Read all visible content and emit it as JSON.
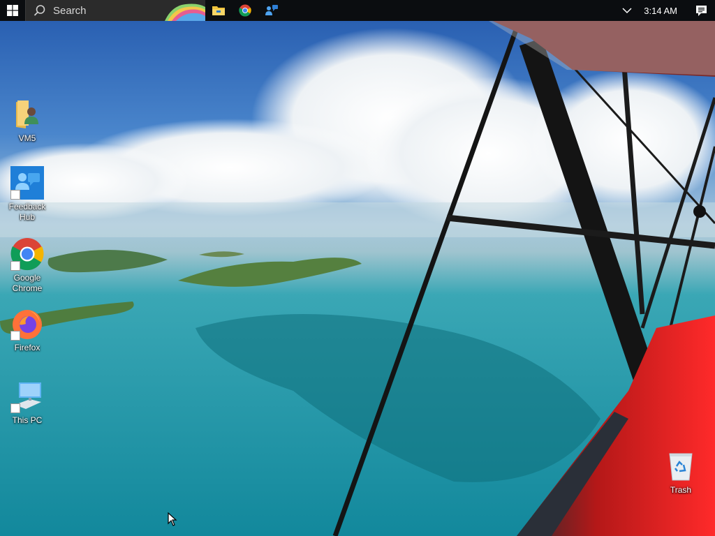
{
  "taskbar": {
    "search_placeholder": "Search",
    "start_icon": "windows-logo-icon",
    "pinned": [
      {
        "name": "file-explorer-icon"
      },
      {
        "name": "chrome-icon"
      },
      {
        "name": "quick-assist-icon"
      }
    ],
    "clock": "3:14 AM",
    "tray_chevron_icon": "chevron-down-icon",
    "notification_icon": "action-center-icon"
  },
  "desktop": {
    "icons": [
      {
        "id": "vm5",
        "label": "VM5",
        "icon": "user-folder-icon"
      },
      {
        "id": "feedback-hub",
        "label": "Feedback Hub",
        "icon": "feedback-hub-icon"
      },
      {
        "id": "google-chrome",
        "label": "Google Chrome",
        "icon": "chrome-icon"
      },
      {
        "id": "firefox",
        "label": "Firefox",
        "icon": "firefox-icon"
      },
      {
        "id": "this-pc",
        "label": "This PC",
        "icon": "computer-icon"
      },
      {
        "id": "trash",
        "label": "Trash",
        "icon": "recycle-bin-icon"
      }
    ]
  },
  "colors": {
    "taskbar_bg": "#0b0d10",
    "search_bg": "#2b2b2b",
    "wing_red": "#e02626"
  }
}
